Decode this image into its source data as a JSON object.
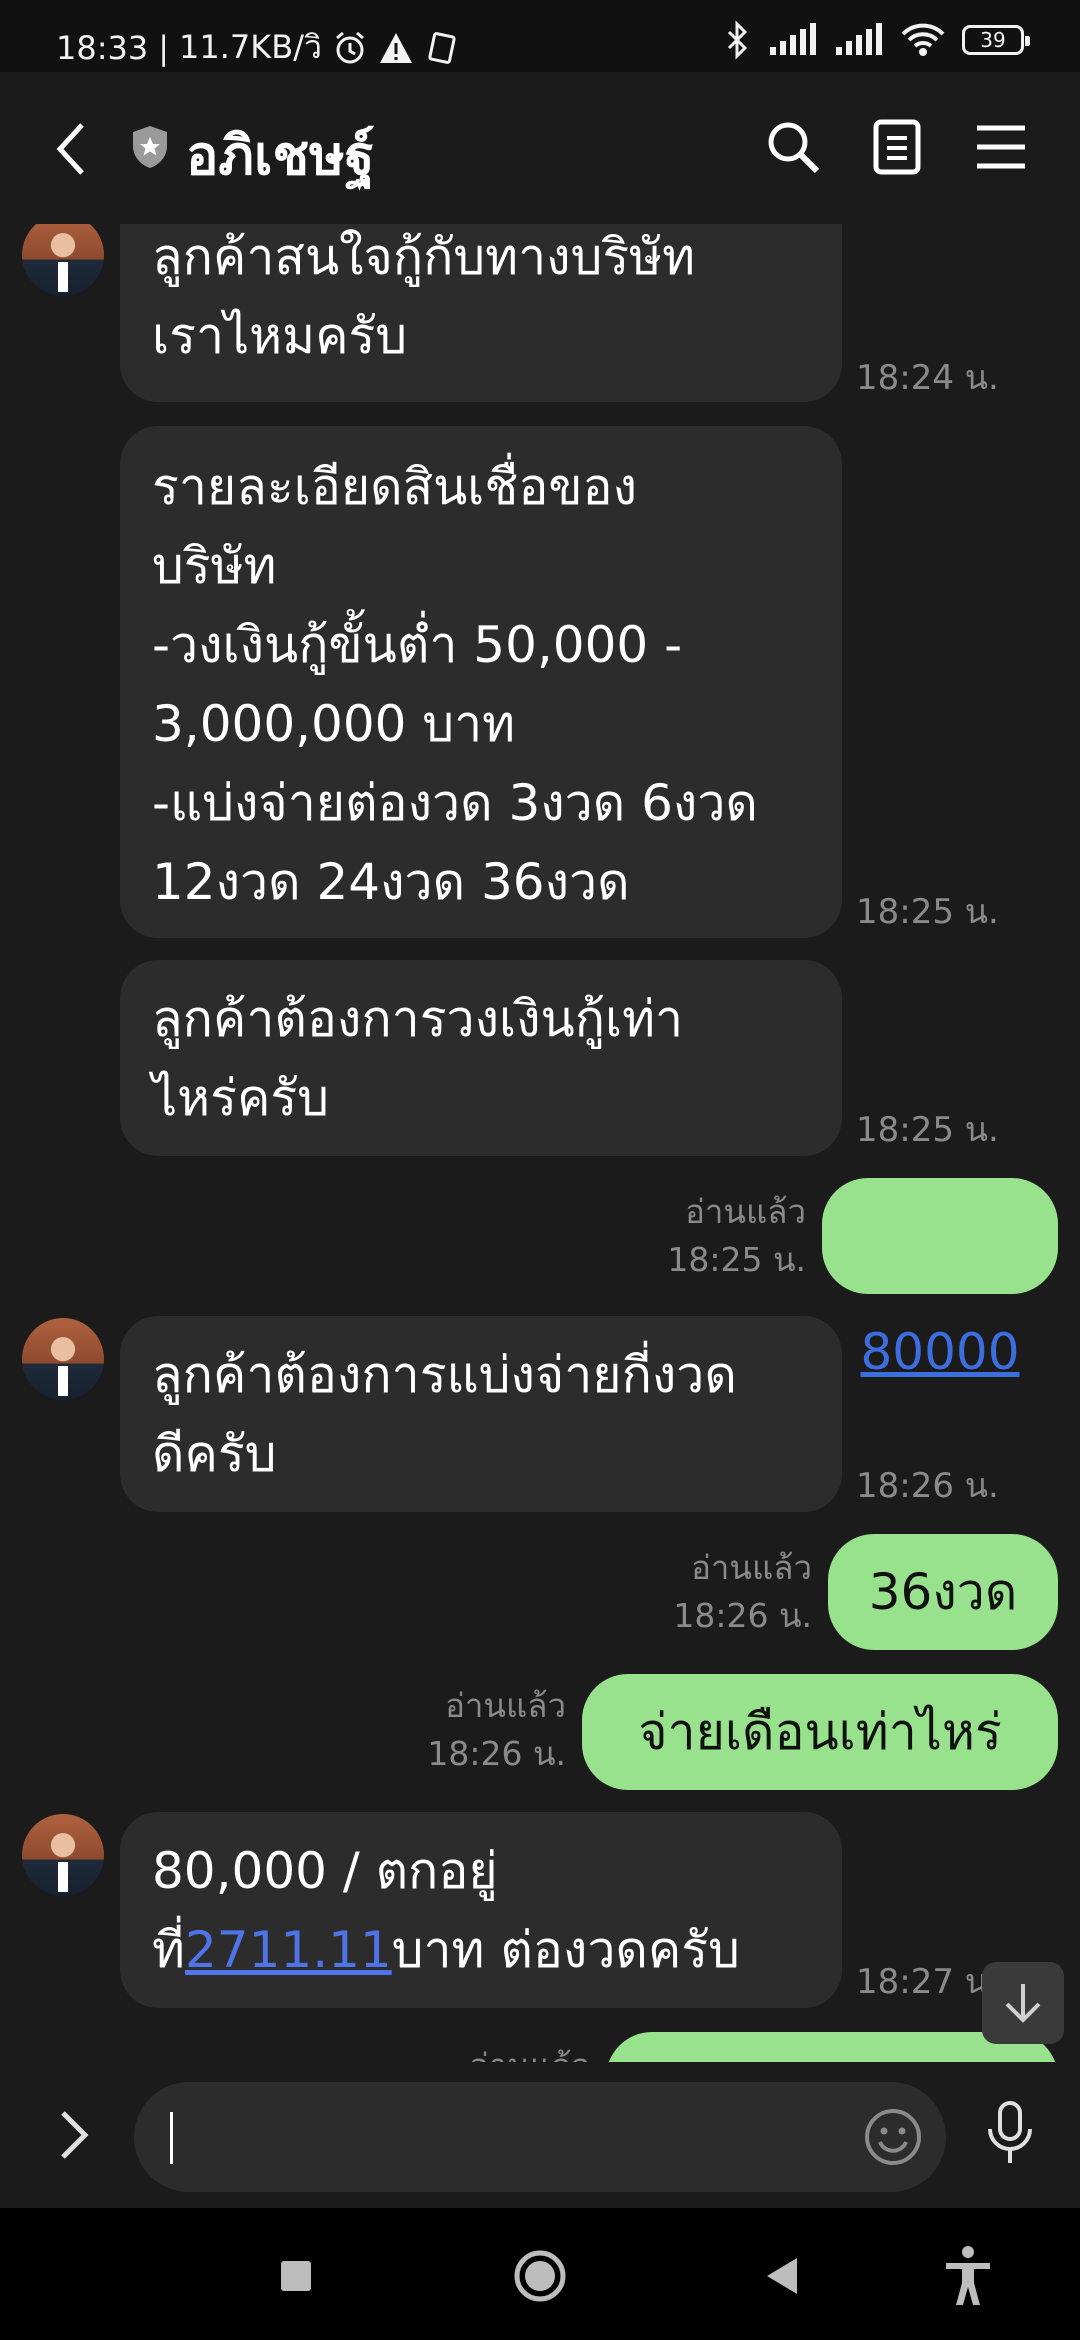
{
  "status_bar": {
    "time": "18:33",
    "network_speed": "11.7KB/วิ",
    "battery": "39"
  },
  "header": {
    "title": "อภิเชษฐ์"
  },
  "messages": [
    {
      "direction": "in",
      "text": "ลูกค้าสนใจกู้กับทางบริษัท\nเราไหมครับ",
      "time": "18:24 น."
    },
    {
      "direction": "in",
      "text": "รายละเอียดสินเชื่อของ\nบริษัท\n-วงเงินกู้ขั้นต่ำ 50,000 -\n3,000,000 บาท\n-แบ่งจ่ายต่องวด 3งวด 6งวด\n12งวด 24งวด 36งวด",
      "time": "18:25 น."
    },
    {
      "direction": "in",
      "text": "ลูกค้าต้องการวงเงินกู้เท่า\nไหร่ครับ",
      "time": "18:25 น."
    },
    {
      "direction": "out",
      "text": "80000",
      "read": "อ่านแล้ว",
      "time": "18:25 น."
    },
    {
      "direction": "in",
      "text": "ลูกค้าต้องการแบ่งจ่ายกี่งวด\nดีครับ",
      "time": "18:26 น."
    },
    {
      "direction": "out",
      "text": "36งวด",
      "read": "อ่านแล้ว",
      "time": "18:26 น."
    },
    {
      "direction": "out",
      "text": "จ่ายเดือนเท่าไหร่",
      "read": "อ่านแล้ว",
      "time": "18:26 น."
    },
    {
      "direction": "in",
      "text_line1": "80,000 / ตกอยู่",
      "text_prefix": "ที่",
      "text_link": "2711.11",
      "text_suffix": "บาท ต่องวดครับ",
      "time": "18:27 น."
    },
    {
      "direction": "out",
      "read": "อ่านแล้ว"
    }
  ],
  "colors": {
    "background": "#1b1b1b",
    "incoming_bubble": "#2c2c2c",
    "outgoing_bubble": "#99e28d",
    "link": "#4e74e8"
  },
  "icons": [
    "back-icon",
    "shield-icon",
    "search-icon",
    "notes-icon",
    "menu-icon",
    "scroll-down-icon",
    "expand-icon",
    "emoji-icon",
    "mic-icon",
    "recent-apps-icon",
    "home-icon",
    "back-nav-icon",
    "accessibility-icon"
  ]
}
